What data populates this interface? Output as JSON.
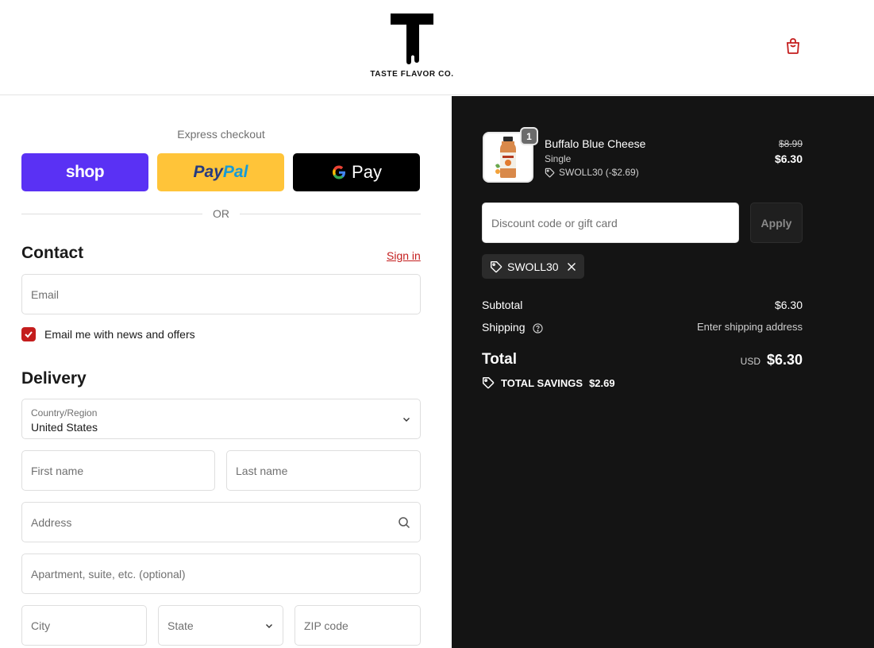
{
  "header": {
    "brand_name": "TASTE FLAVOR CO.",
    "cart_icon": "shopping-bag-icon"
  },
  "express": {
    "title": "Express checkout",
    "shop_label": "shop",
    "paypal_label_1": "Pay",
    "paypal_label_2": "Pal",
    "gpay_label": "Pay",
    "or_label": "OR"
  },
  "contact": {
    "title": "Contact",
    "sign_in": "Sign in",
    "email_placeholder": "Email",
    "newsletter_label": "Email me with news and offers",
    "newsletter_checked": true
  },
  "delivery": {
    "title": "Delivery",
    "country_label": "Country/Region",
    "country_value": "United States",
    "first_name_placeholder": "First name",
    "last_name_placeholder": "Last name",
    "address_placeholder": "Address",
    "apartment_placeholder": "Apartment, suite, etc. (optional)",
    "city_placeholder": "City",
    "state_placeholder": "State",
    "zip_placeholder": "ZIP code"
  },
  "summary": {
    "item": {
      "quantity": "1",
      "name": "Buffalo Blue Cheese",
      "variant": "Single",
      "discount": "SWOLL30 (-$2.69)",
      "original_price": "$8.99",
      "price": "$6.30"
    },
    "discount_placeholder": "Discount code or gift card",
    "apply_label": "Apply",
    "applied_code": "SWOLL30",
    "subtotal_label": "Subtotal",
    "subtotal_value": "$6.30",
    "shipping_label": "Shipping",
    "shipping_value": "Enter shipping address",
    "total_label": "Total",
    "currency": "USD",
    "total_value": "$6.30",
    "savings_label": "TOTAL SAVINGS",
    "savings_value": "$2.69"
  },
  "colors": {
    "accent": "#c41d1d",
    "shop_purple": "#5a31f4",
    "paypal_yellow": "#ffc439",
    "summary_bg": "#141414"
  }
}
